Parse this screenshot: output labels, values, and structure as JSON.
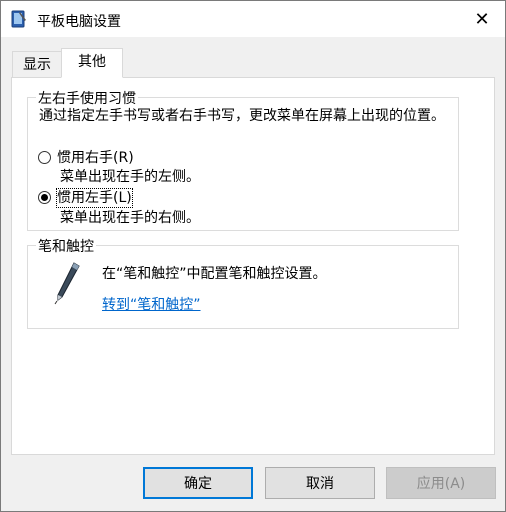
{
  "window": {
    "title": "平板电脑设置",
    "icon": "tablet-pc-icon",
    "close_glyph": "✕"
  },
  "tabs": [
    {
      "label": "显示",
      "selected": false
    },
    {
      "label": "其他",
      "selected": true
    }
  ],
  "handedness": {
    "group_label": "左右手使用习惯",
    "description": "通过指定左手书写或者右手书写，更改菜单在屏幕上出现的位置。",
    "options": [
      {
        "label": "惯用右手(R)",
        "sub": "菜单出现在手的左侧。",
        "checked": false
      },
      {
        "label": "惯用左手(L)",
        "sub": "菜单出现在手的右侧。",
        "checked": true
      }
    ]
  },
  "pen_touch": {
    "group_label": "笔和触控",
    "icon": "pen-icon",
    "text": "在“笔和触控”中配置笔和触控设置。",
    "link": "转到“笔和触控”"
  },
  "buttons": {
    "ok": "确定",
    "cancel": "取消",
    "apply": "应用(A)"
  }
}
